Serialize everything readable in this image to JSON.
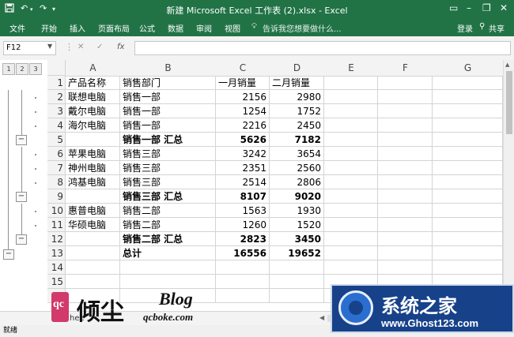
{
  "app": {
    "title": "新建 Microsoft Excel 工作表 (2).xlsx - Excel",
    "ribbon_tabs": [
      "文件",
      "开始",
      "插入",
      "页面布局",
      "公式",
      "数据",
      "审阅",
      "视图"
    ],
    "tell_me": "告诉我您想要做什么...",
    "login": "登录",
    "share": "共享",
    "name_box": "F12",
    "formula_fx": "fx",
    "status": "就绪",
    "accent": "#217346"
  },
  "outline": {
    "levels": [
      "1",
      "2",
      "3"
    ],
    "collapse_symbol": "−"
  },
  "columns": [
    "A",
    "B",
    "C",
    "D",
    "E",
    "F",
    "G"
  ],
  "row_numbers": [
    "1",
    "2",
    "3",
    "4",
    "5",
    "6",
    "7",
    "8",
    "9",
    "10",
    "11",
    "12",
    "13",
    "14",
    "15",
    "1"
  ],
  "rows": [
    {
      "a": "产品名称",
      "b": "销售部门",
      "c": "一月销量",
      "d": "二月销量",
      "bold": false,
      "header": true
    },
    {
      "a": "联想电脑",
      "b": "销售一部",
      "c": "2156",
      "d": "2980",
      "bold": false
    },
    {
      "a": "戴尔电脑",
      "b": "销售一部",
      "c": "1254",
      "d": "1752",
      "bold": false
    },
    {
      "a": "海尔电脑",
      "b": "销售一部",
      "c": "2216",
      "d": "2450",
      "bold": false
    },
    {
      "a": "",
      "b": "销售一部 汇总",
      "c": "5626",
      "d": "7182",
      "bold": true
    },
    {
      "a": "苹果电脑",
      "b": "销售三部",
      "c": "3242",
      "d": "3654",
      "bold": false
    },
    {
      "a": "神州电脑",
      "b": "销售三部",
      "c": "2351",
      "d": "2560",
      "bold": false
    },
    {
      "a": "鸿基电脑",
      "b": "销售三部",
      "c": "2514",
      "d": "2806",
      "bold": false
    },
    {
      "a": "",
      "b": "销售三部 汇总",
      "c": "8107",
      "d": "9020",
      "bold": true
    },
    {
      "a": "惠普电脑",
      "b": "销售二部",
      "c": "1563",
      "d": "1930",
      "bold": false
    },
    {
      "a": "华硕电脑",
      "b": "销售二部",
      "c": "1260",
      "d": "1520",
      "bold": false
    },
    {
      "a": "",
      "b": "销售二部 汇总",
      "c": "2823",
      "d": "3450",
      "bold": true
    },
    {
      "a": "",
      "b": "总计",
      "c": "16556",
      "d": "19652",
      "bold": true
    }
  ],
  "sheet_tab_partial": "hee",
  "watermarks": {
    "left": {
      "mark": "qc",
      "name": "倾尘",
      "blog": "Blog",
      "url": "qcboke.com"
    },
    "right": {
      "name": "系统之家",
      "url": "www.Ghost123.com"
    }
  }
}
